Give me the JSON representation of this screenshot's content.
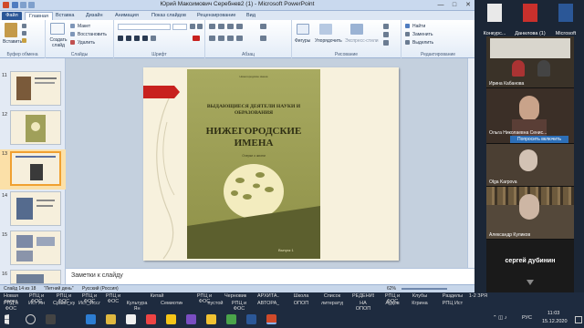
{
  "app": {
    "window_title": "Юрий Максимович Серебнев2 (1) - Microsoft PowerPoint",
    "window_controls": [
      "—",
      "□",
      "✕"
    ]
  },
  "ribbon_tabs": [
    {
      "label": "Файл"
    },
    {
      "label": "Главная"
    },
    {
      "label": "Вставка"
    },
    {
      "label": "Дизайн"
    },
    {
      "label": "Анимация"
    },
    {
      "label": "Показ слайдов"
    },
    {
      "label": "Рецензирование"
    },
    {
      "label": "Вид"
    }
  ],
  "ribbon": {
    "paste_label": "Вставить",
    "cut_label": "Вырезать",
    "copy_label": "Копировать",
    "format_label": "Формат",
    "create_slide_label": "Создать слайд",
    "layout_label": "Макет",
    "restore_label": "Восстановить",
    "delete_label": "Удалить",
    "shapes_label": "Фигуры",
    "arrange_label": "Упорядочить",
    "quick_styles_label": "Экспресс-стили",
    "find_label": "Найти",
    "replace_label": "Заменить",
    "select_label": "Выделить",
    "groups": {
      "clipboard": "Буфер обмена",
      "slides": "Слайды",
      "font": "Шрифт",
      "paragraph": "Абзац",
      "drawing": "Рисование",
      "editing": "Редактирование"
    }
  },
  "thumbnails": [
    {
      "number": "11"
    },
    {
      "number": "12"
    },
    {
      "number": "13"
    },
    {
      "number": "14"
    },
    {
      "number": "15"
    },
    {
      "number": "16"
    }
  ],
  "slide": {
    "cover_top_text": "Нижегородские имена",
    "cover_subtitle": "ВЫДАЮЩИЕСЯ ДЕЯТЕЛИ НАУКИ И ОБРАЗОВАНИЯ",
    "cover_title": "НИЖЕГОРОДСКИЕ ИМЕНА",
    "cover_small": "Очерки о жизни",
    "cover_volume": "Выпуск 1"
  },
  "notes_placeholder": "Заметки к слайду",
  "status": {
    "slide_counter": "Слайд 14 из 18",
    "theme": "\"Летний день\"",
    "language": "Русский (Россия)",
    "zoom": "62%"
  },
  "desktop_icons": [
    {
      "label": "Конкурс..."
    },
    {
      "label": "Данилова (1)"
    },
    {
      "label": "Microsoft"
    }
  ],
  "participants": [
    {
      "name": "Ирина Кабанова"
    },
    {
      "name": "Ольга Николаевна Сенис..."
    },
    {
      "name": "Попросить включить"
    },
    {
      "name": "Olga Karpova"
    },
    {
      "name": "Александр Куликов"
    },
    {
      "name": "сергей дубинин"
    }
  ],
  "taskbar_labels": [
    "Новая папка",
    "РПЦ и ФОС",
    "РПЦ и ФОС",
    "РПЦ и ФОС",
    "РПЦ и ФОС",
    "Китай",
    "РПЦ и ФОС",
    "Черновики",
    "АРХИТА...",
    "Школа",
    "Список",
    "РЕДЕНИЯ",
    "РПЦ и ФОС",
    "Клубы",
    "Разделы",
    "1-2 ЗРЯ"
  ],
  "taskbar_labels2": [
    "РПД и ФОС",
    "Ист Ян",
    "Сравн_культ...",
    "Ист_Исслед...",
    "Культура Ян",
    "Семиотика",
    "пустой",
    "РПЦ и ФОС",
    "АВТОРА_...",
    "ОПОП",
    "литератур...",
    "НА ОПОП",
    "Аудов",
    "Кгрина",
    "РПЦ Ист"
  ],
  "tray": {
    "lang": "РУС",
    "time": "11:03",
    "date": "15.12.2020"
  },
  "colors": {
    "file_tab": "#2b5797",
    "selection": "#f0a030",
    "book_green": "#9a9c52",
    "tree": "#f3ecbf",
    "red_ribbon": "#c8211e"
  }
}
